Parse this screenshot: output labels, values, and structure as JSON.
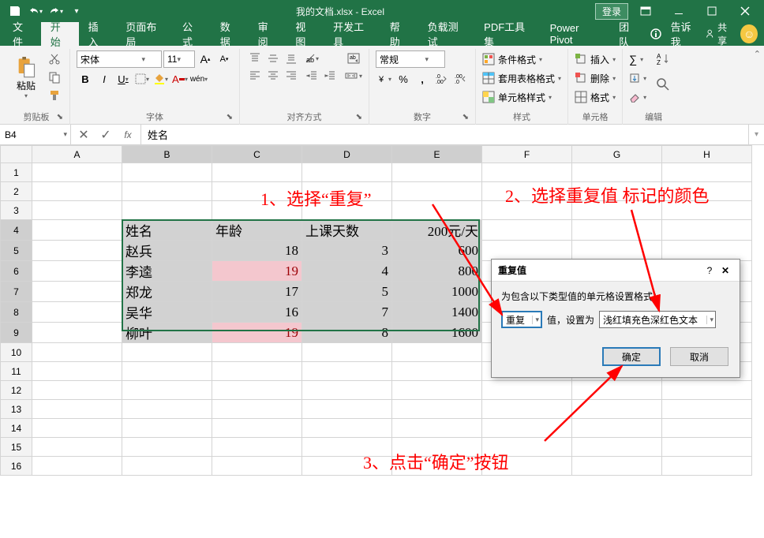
{
  "title": "我的文档.xlsx - Excel",
  "login": "登录",
  "tabs": [
    "文件",
    "开始",
    "插入",
    "页面布局",
    "公式",
    "数据",
    "审阅",
    "视图",
    "开发工具",
    "帮助",
    "负载测试",
    "PDF工具集",
    "Power Pivot",
    "团队"
  ],
  "active_tab": "开始",
  "share": "共享",
  "tellme": "告诉我",
  "ribbon": {
    "clipboard": {
      "paste": "粘贴",
      "label": "剪贴板"
    },
    "font": {
      "label": "字体",
      "name": "宋体",
      "size": "11",
      "bold": "B",
      "italic": "I",
      "underline": "U",
      "wen": "wén",
      "A_inc": "A",
      "A_dec": "A"
    },
    "align": {
      "label": "对齐方式",
      "wrap": "ab"
    },
    "number": {
      "label": "数字",
      "format": "常规",
      "percent": "%",
      "comma": ",",
      "dec_inc": "",
      "dec_dec": ""
    },
    "styles": {
      "label": "样式",
      "cond": "条件格式",
      "table": "套用表格格式",
      "cell": "单元格样式"
    },
    "cells": {
      "label": "单元格",
      "insert": "插入",
      "delete": "删除",
      "format": "格式"
    },
    "editing": {
      "label": "编辑"
    }
  },
  "namebox": "B4",
  "formula_value": "姓名",
  "col_headers": [
    "A",
    "B",
    "C",
    "D",
    "E",
    "F",
    "G",
    "H"
  ],
  "rows": [
    {
      "r": 1,
      "cells": [
        "",
        "",
        "",
        "",
        "",
        "",
        "",
        ""
      ]
    },
    {
      "r": 2,
      "cells": [
        "",
        "",
        "",
        "",
        "",
        "",
        "",
        ""
      ]
    },
    {
      "r": 3,
      "cells": [
        "",
        "",
        "",
        "",
        "",
        "",
        "",
        ""
      ]
    },
    {
      "r": 4,
      "cells": [
        "",
        "姓名",
        "年龄",
        "上课天数",
        "200元/天",
        "",
        "",
        ""
      ],
      "sel": true
    },
    {
      "r": 5,
      "cells": [
        "",
        "赵兵",
        "18",
        "3",
        "600",
        "",
        "",
        ""
      ],
      "sel": true
    },
    {
      "r": 6,
      "cells": [
        "",
        "李逵",
        "19",
        "4",
        "800",
        "",
        "",
        ""
      ],
      "sel": true,
      "dup": [
        2
      ]
    },
    {
      "r": 7,
      "cells": [
        "",
        "郑龙",
        "17",
        "5",
        "1000",
        "",
        "",
        ""
      ],
      "sel": true
    },
    {
      "r": 8,
      "cells": [
        "",
        "吴华",
        "16",
        "7",
        "1400",
        "",
        "",
        ""
      ],
      "sel": true
    },
    {
      "r": 9,
      "cells": [
        "",
        "柳叶",
        "19",
        "8",
        "1600",
        "",
        "",
        ""
      ],
      "sel": true,
      "dup": [
        2
      ]
    },
    {
      "r": 10,
      "cells": [
        "",
        "",
        "",
        "",
        "",
        "",
        "",
        ""
      ]
    },
    {
      "r": 11,
      "cells": [
        "",
        "",
        "",
        "",
        "",
        "",
        "",
        ""
      ]
    },
    {
      "r": 12,
      "cells": [
        "",
        "",
        "",
        "",
        "",
        "",
        "",
        ""
      ]
    },
    {
      "r": 13,
      "cells": [
        "",
        "",
        "",
        "",
        "",
        "",
        "",
        ""
      ]
    },
    {
      "r": 14,
      "cells": [
        "",
        "",
        "",
        "",
        "",
        "",
        "",
        ""
      ]
    },
    {
      "r": 15,
      "cells": [
        "",
        "",
        "",
        "",
        "",
        "",
        "",
        ""
      ]
    },
    {
      "r": 16,
      "cells": [
        "",
        "",
        "",
        "",
        "",
        "",
        "",
        ""
      ]
    }
  ],
  "dialog": {
    "title": "重复值",
    "desc": "为包含以下类型值的单元格设置格式：",
    "select1": "重复",
    "mid": "值，设置为",
    "select2": "浅红填充色深红色文本",
    "ok": "确定",
    "cancel": "取消"
  },
  "annotations": {
    "a1": "1、选择“重复”",
    "a2": "2、选择重复值 标记的颜色",
    "a3": "3、点击“确定”按钮"
  }
}
